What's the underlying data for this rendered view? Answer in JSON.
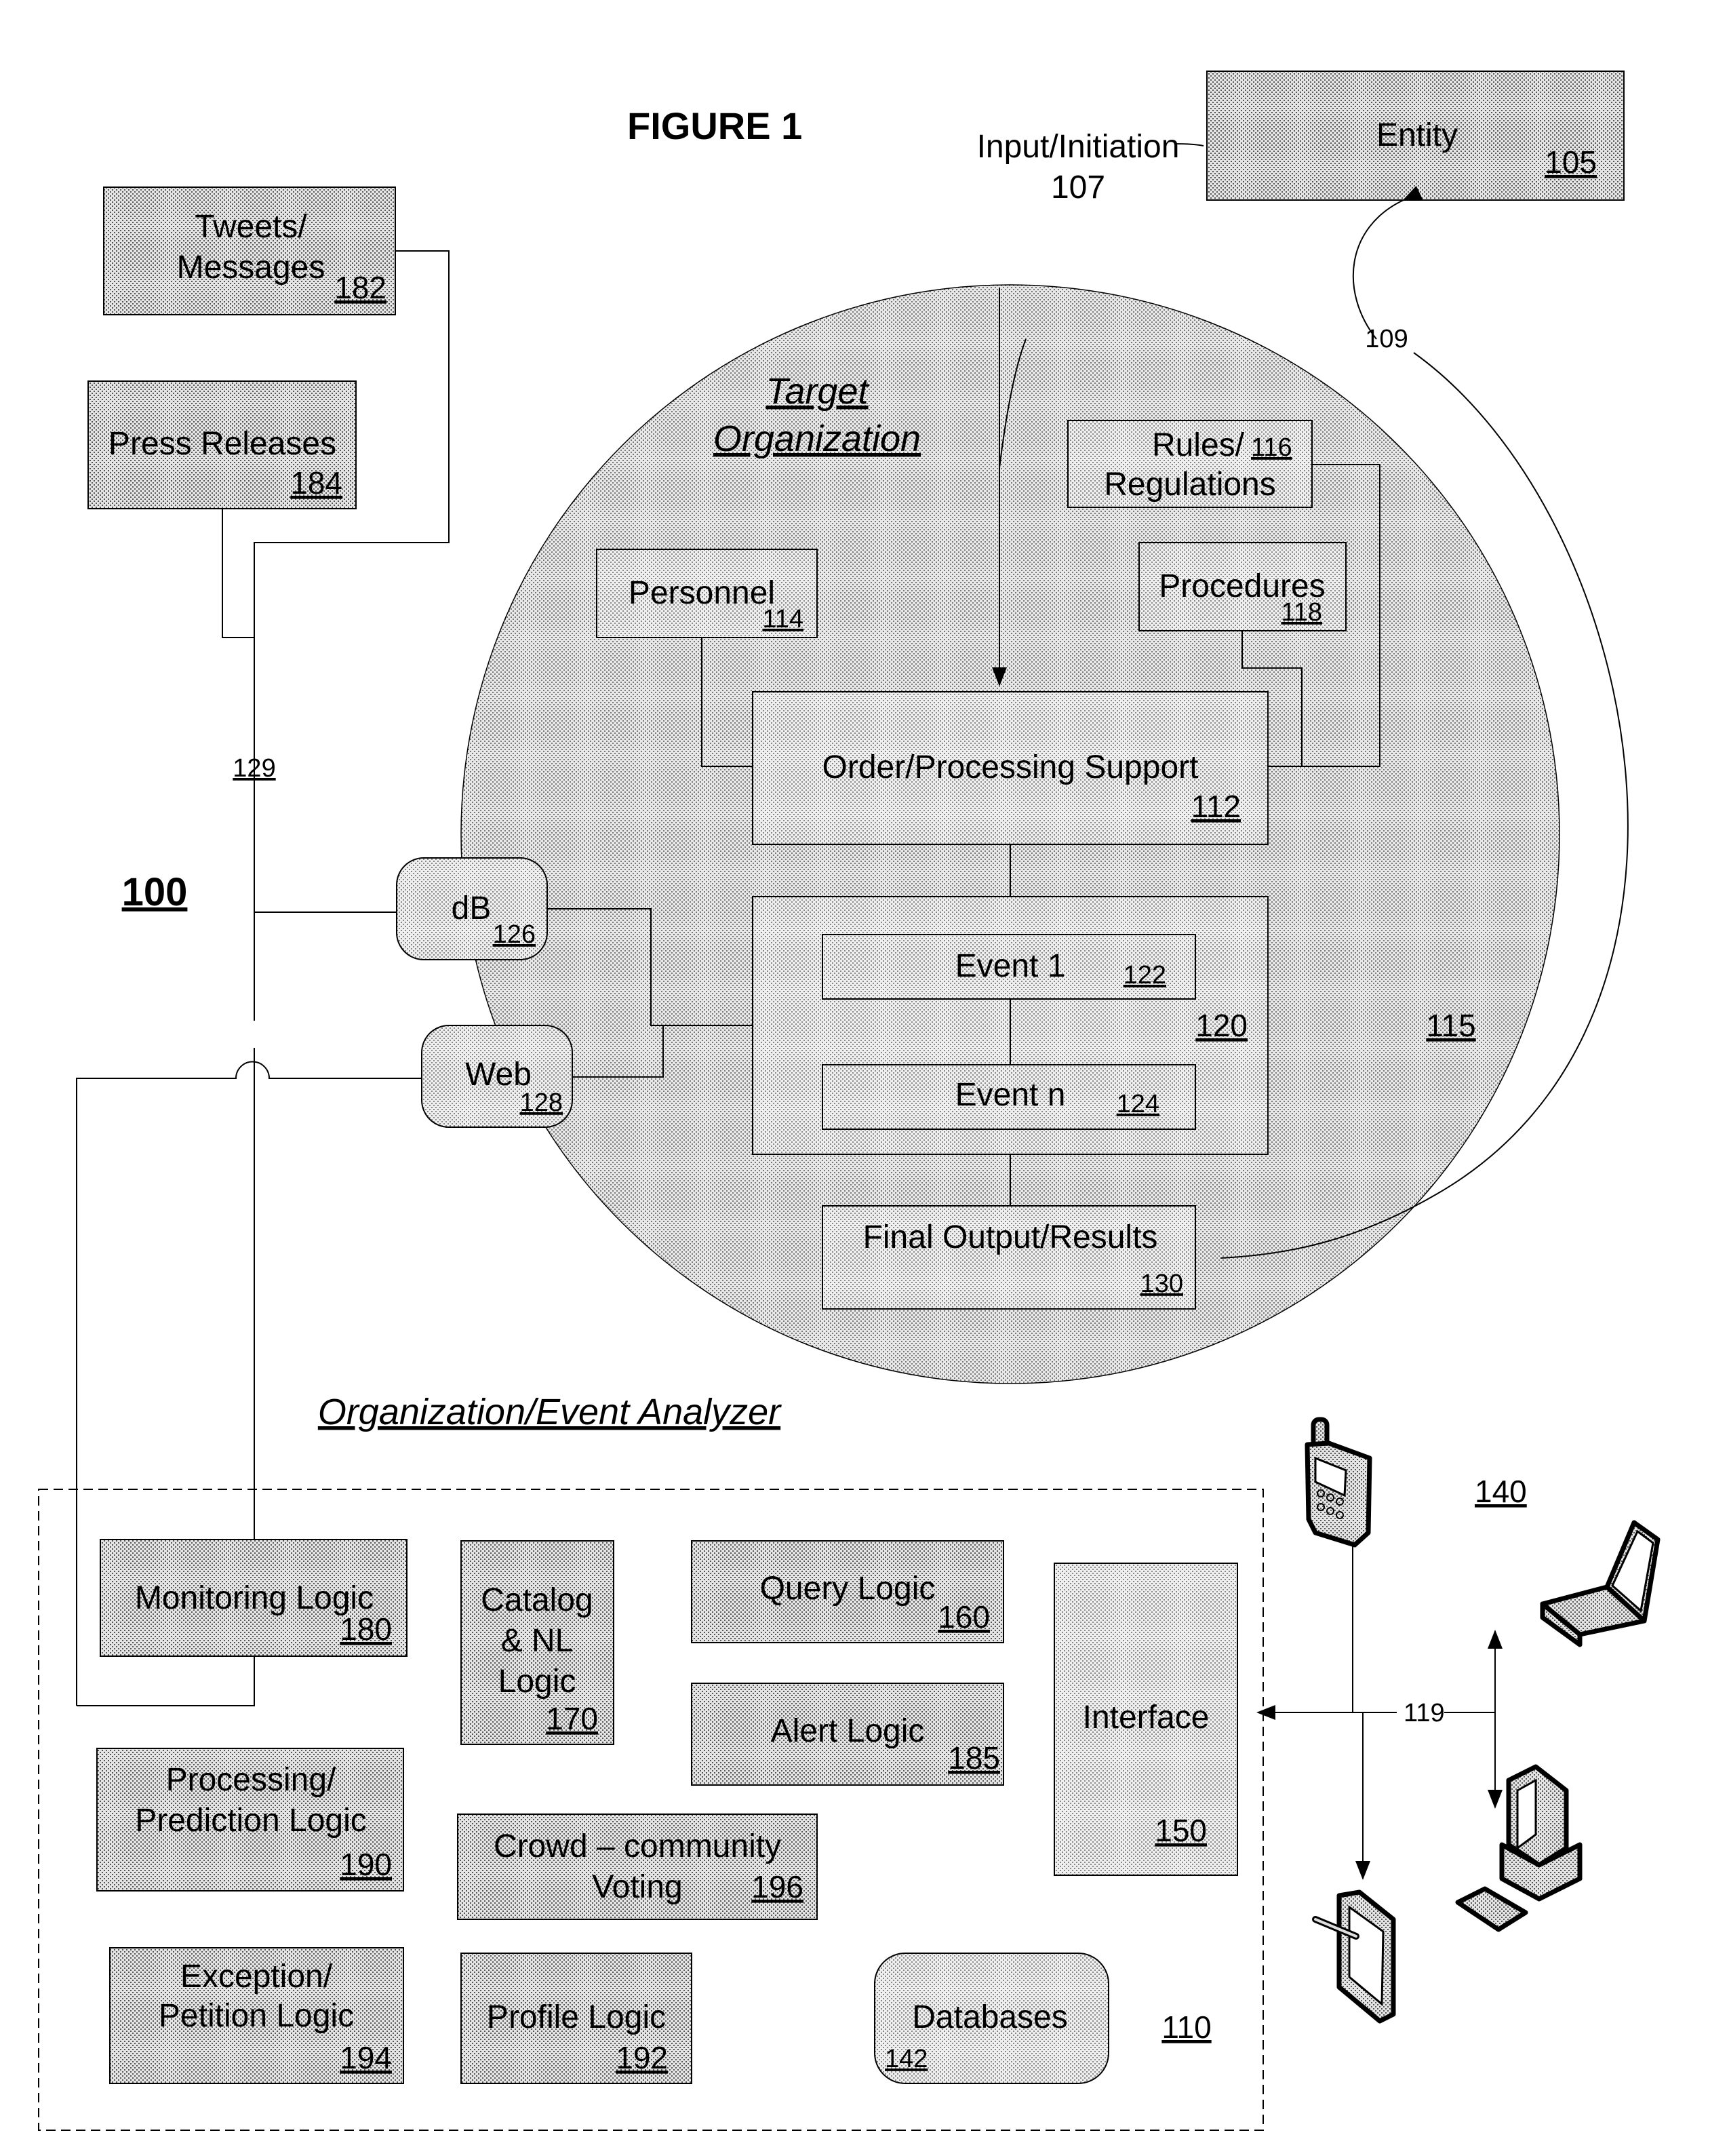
{
  "figure_title": "FIGURE 1",
  "system_ref": "100",
  "entity": {
    "label": "Entity",
    "ref": "105"
  },
  "input": {
    "label": "Input/Initiation",
    "ref": "107"
  },
  "feedback_ref": "109",
  "feed_line_ref": "129",
  "sources": [
    {
      "line1": "Tweets/",
      "line2": "Messages",
      "ref": "182"
    },
    {
      "line1": "Press Releases",
      "ref": "184"
    }
  ],
  "target_org": {
    "heading_line1": "Target",
    "heading_line2": "Organization",
    "ref": "115",
    "rules": {
      "line1": "Rules/",
      "line2": "Regulations",
      "ref": "116"
    },
    "personnel": {
      "label": "Personnel",
      "ref": "114"
    },
    "procedures": {
      "label": "Procedures",
      "ref": "118"
    },
    "order": {
      "label": "Order/Processing Support",
      "ref": "112"
    },
    "events_ref": "120",
    "event1": {
      "label": "Event 1",
      "ref": "122"
    },
    "eventn": {
      "label": "Event n",
      "ref": "124"
    },
    "final": {
      "label": "Final Output/Results",
      "ref": "130"
    }
  },
  "db": {
    "label": "dB",
    "ref": "126"
  },
  "web": {
    "label": "Web",
    "ref": "128"
  },
  "analyzer": {
    "heading": "Organization/Event Analyzer",
    "ref": "110",
    "monitoring": {
      "label": "Monitoring Logic",
      "ref": "180"
    },
    "catalog": {
      "line1": "Catalog",
      "line2": "& NL",
      "line3": "Logic",
      "ref": "170"
    },
    "query": {
      "label": "Query Logic",
      "ref": "160"
    },
    "alert": {
      "label": "Alert Logic",
      "ref": "185"
    },
    "processing": {
      "line1": "Processing/",
      "line2": "Prediction Logic",
      "ref": "190"
    },
    "crowd": {
      "line1": "Crowd – community",
      "line2": "Voting",
      "ref": "196"
    },
    "exception": {
      "line1": "Exception/",
      "line2": "Petition Logic",
      "ref": "194"
    },
    "profile": {
      "label": "Profile Logic",
      "ref": "192"
    },
    "databases": {
      "label": "Databases",
      "ref": "142"
    },
    "interface": {
      "label": "Interface",
      "ref": "150"
    }
  },
  "devices": {
    "ref": "140",
    "link_ref": "119",
    "items": [
      "mobile-phone-icon",
      "laptop-icon",
      "desktop-computer-icon",
      "tablet-icon"
    ]
  }
}
